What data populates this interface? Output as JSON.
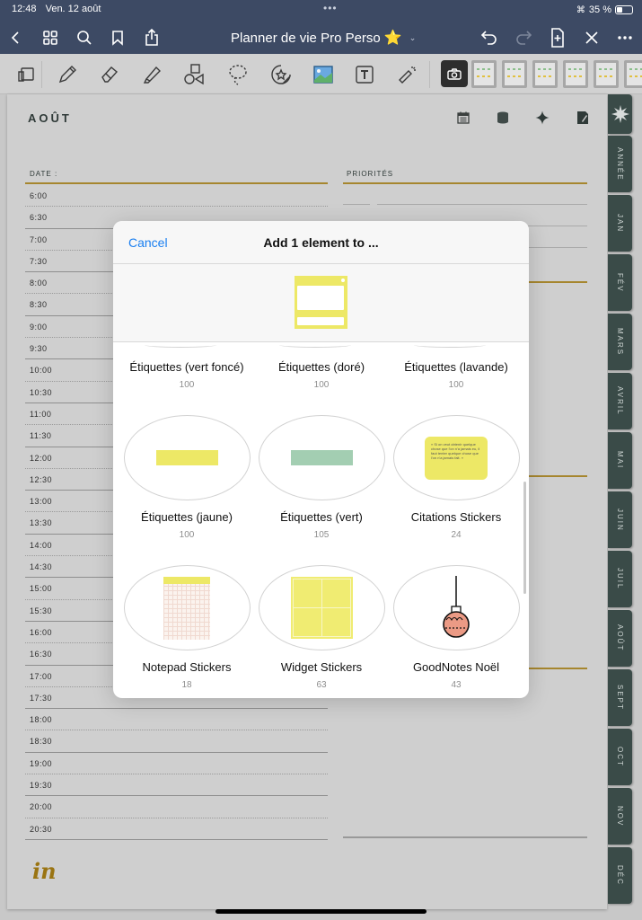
{
  "status_bar": {
    "time": "12:48",
    "date": "Ven. 12 août",
    "battery": "35 %",
    "battery_level_percent": 35
  },
  "nav_bar": {
    "title": "Planner de vie Pro Perso",
    "title_emoji": "⭐",
    "left_icons": [
      "back-icon",
      "grid-icon",
      "search-icon",
      "bookmark-icon",
      "share-icon"
    ],
    "right_icons": [
      "undo-icon",
      "redo-icon",
      "add-page-icon",
      "close-icon",
      "more-icon"
    ]
  },
  "toolbar": {
    "tools": [
      "read-mode-icon",
      "pen-icon",
      "eraser-icon",
      "highlighter-icon",
      "shapes-icon",
      "lasso-icon",
      "sticker-icon",
      "image-icon",
      "text-icon",
      "laser-pointer-icon"
    ],
    "camera_label": "camera-icon",
    "template_thumbnails": 6
  },
  "planner": {
    "month": "AOÛT",
    "header_icons": [
      "calendar-icon",
      "database-icon",
      "sparkle-icon",
      "notes-icon"
    ],
    "date_label": "DATE :",
    "priorities_label": "PRIORITÉS",
    "times": [
      "6:00",
      "6:30",
      "7:00",
      "7:30",
      "8:00",
      "8:30",
      "9:00",
      "9:30",
      "10:00",
      "10:30",
      "11:00",
      "11:30",
      "12:00",
      "12:30",
      "13:00",
      "13:30",
      "14:00",
      "14:30",
      "15:00",
      "15:30",
      "16:00",
      "16:30",
      "17:00",
      "17:30",
      "18:00",
      "18:30",
      "19:00",
      "19:30",
      "20:00",
      "20:30"
    ],
    "logo": "in"
  },
  "side_tabs": [
    "ANNÉE",
    "JAN",
    "FÉV",
    "MARS",
    "AVRIL",
    "MAI",
    "JUIN",
    "JUIL",
    "AOÛT",
    "SEPT",
    "OCT",
    "NOV",
    "DÉC"
  ],
  "modal": {
    "cancel_label": "Cancel",
    "title": "Add 1 element to ...",
    "top_row": [
      {
        "name": "Étiquettes (vert foncé)",
        "count": "100"
      },
      {
        "name": "Étiquettes (doré)",
        "count": "100"
      },
      {
        "name": "Étiquettes (lavande)",
        "count": "100"
      }
    ],
    "rows": [
      [
        {
          "name": "Étiquettes (jaune)",
          "count": "100",
          "thumb": "yellow-label"
        },
        {
          "name": "Étiquettes (vert)",
          "count": "105",
          "thumb": "green-label"
        },
        {
          "name": "Citations Stickers",
          "count": "24",
          "thumb": "quote-card",
          "quote": "« Si on veut obtenir quelque chose que l'on n'a jamais eu, il faut tenter quelque chose que l'on n'a jamais fait. »"
        }
      ],
      [
        {
          "name": "Notepad Stickers",
          "count": "18",
          "thumb": "notepad"
        },
        {
          "name": "Widget Stickers",
          "count": "63",
          "thumb": "widget"
        },
        {
          "name": "GoodNotes Noël",
          "count": "43",
          "thumb": "ornament"
        }
      ]
    ]
  },
  "colors": {
    "nav_bg": "#3d4a64",
    "accent_blue": "#1a7ff0",
    "gold": "#a6862e",
    "tab_bg": "#3a4b48",
    "label_yellow": "#ede866",
    "label_green": "#a3ceb2"
  }
}
